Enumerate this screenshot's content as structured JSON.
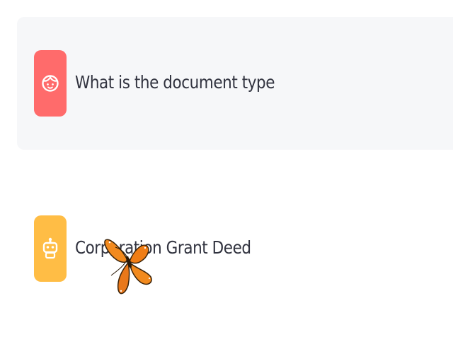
{
  "messages": [
    {
      "role": "user",
      "text": "What is the document type",
      "avatar_icon": "user-face-icon",
      "avatar_color": "#ff6b6b"
    },
    {
      "role": "assistant",
      "text": "Corporation Grant Deed",
      "avatar_icon": "robot-icon",
      "avatar_color": "#ffbd45"
    }
  ],
  "colors": {
    "user_bubble_bg": "#f6f7f9",
    "text": "#31333f"
  },
  "overlay": {
    "icon": "butterfly-icon",
    "color": "#f28a1e"
  }
}
